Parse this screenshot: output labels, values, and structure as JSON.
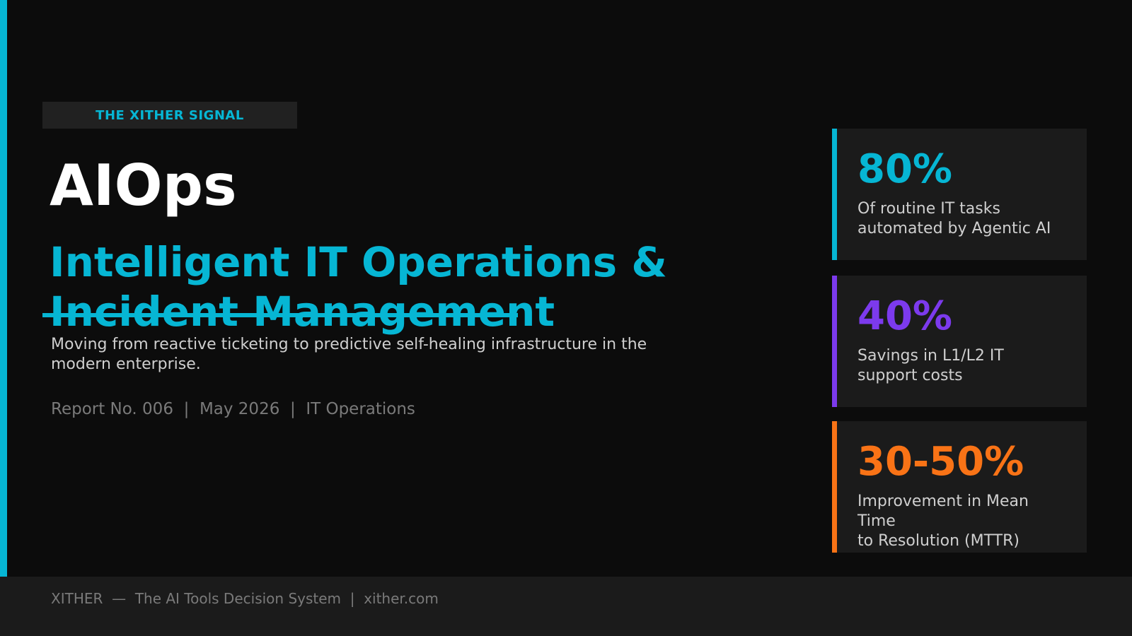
{
  "badge": "THE XITHER SIGNAL",
  "title": "AIOps",
  "subtitle": "Intelligent IT Operations & Incident Management",
  "description": "Moving from reactive ticketing to predictive self-healing infrastructure in the modern enterprise.",
  "meta": "Report No. 006  |  May 2026  |  IT Operations",
  "stats": [
    {
      "value": "80%",
      "label": "Of routine IT tasks\nautomated by Agentic AI",
      "color": "#06b6d4"
    },
    {
      "value": "40%",
      "label": "Savings in L1/L2 IT\nsupport costs",
      "color": "#7c3aed"
    },
    {
      "value": "30-50%",
      "label": "Improvement in Mean\nTime\nto Resolution (MTTR)",
      "color": "#f97316"
    }
  ],
  "footer": "XITHER  —  The AI Tools Decision System  |  xither.com",
  "colors": {
    "accent": "#06b6d4",
    "background": "#0c0c0c",
    "panel": "#1b1b1b"
  }
}
